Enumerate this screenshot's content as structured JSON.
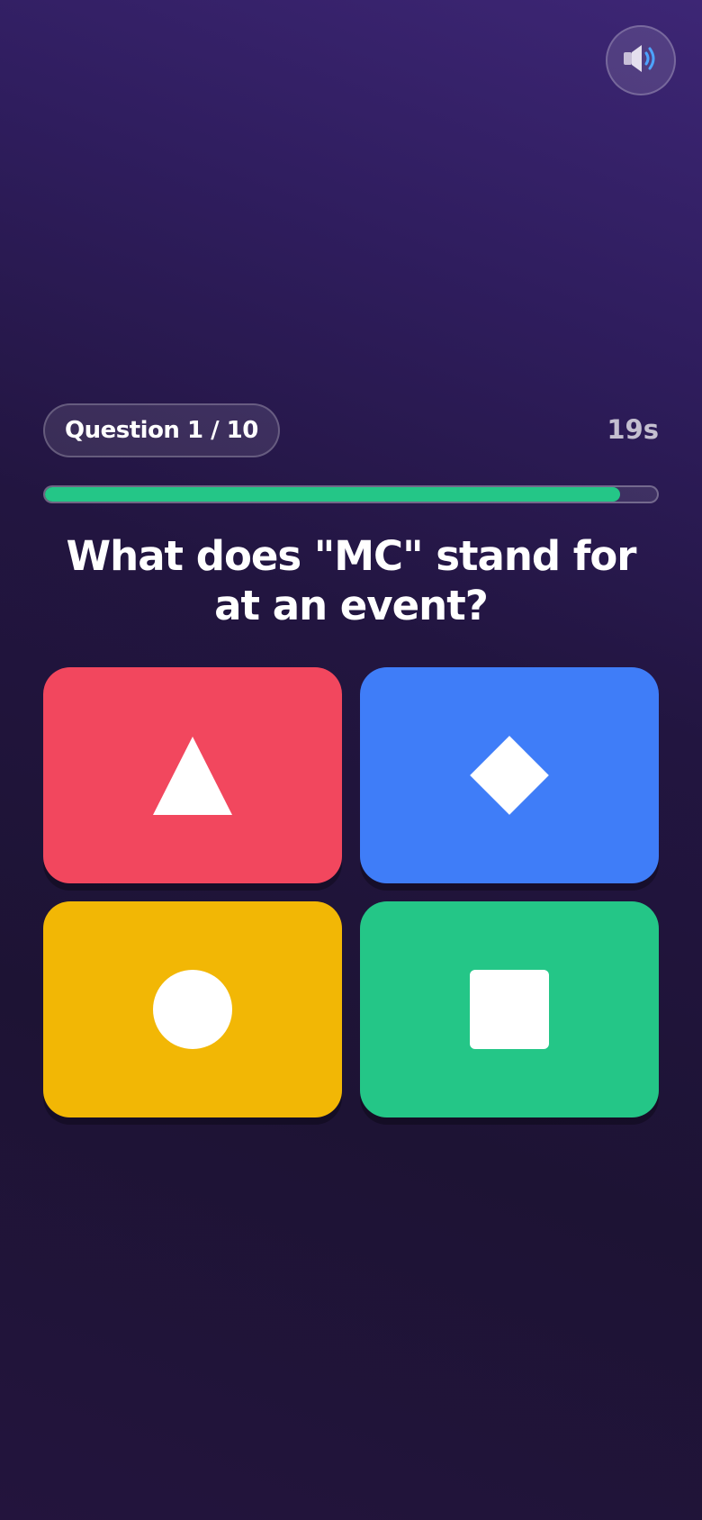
{
  "sound": {
    "icon": "speaker-volume-icon"
  },
  "question": {
    "counter": "Question 1 / 10",
    "timer": "19s",
    "progress_fraction": 0.94,
    "text": "What does \"MC\" stand for at an event?"
  },
  "answers": [
    {
      "color": "#f2475e",
      "icon": "triangle-icon"
    },
    {
      "color": "#3f7df8",
      "icon": "diamond-icon"
    },
    {
      "color": "#f2b705",
      "icon": "circle-icon"
    },
    {
      "color": "#24c687",
      "icon": "square-icon"
    }
  ],
  "colors": {
    "progress": "#24c687",
    "background": "#221540"
  }
}
